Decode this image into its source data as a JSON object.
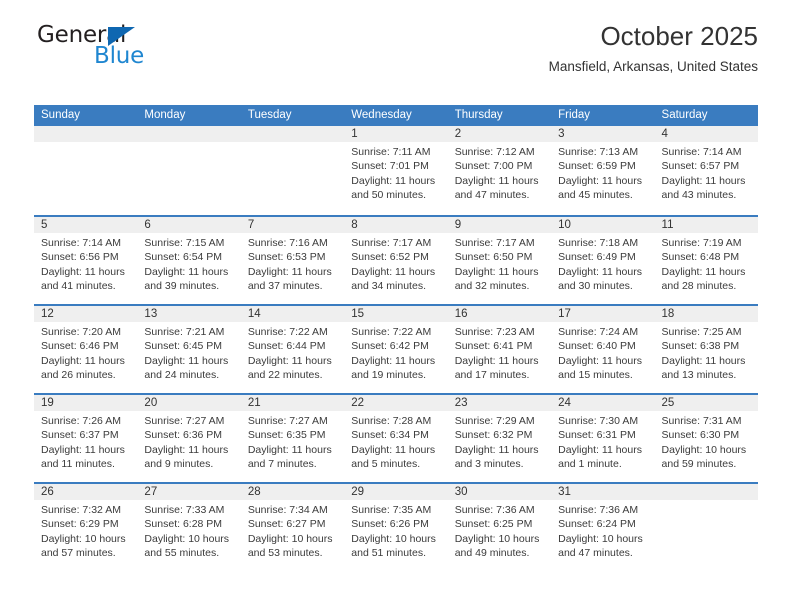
{
  "logo": {
    "word1": "General",
    "word2": "Blue",
    "triangle_color": "#0f67b1",
    "word2_color": "#1f86d0"
  },
  "header": {
    "title": "October 2025",
    "subtitle": "Mansfield, Arkansas, United States"
  },
  "theme": {
    "header_blue": "#3a7cc0",
    "daynum_band": "#efefef"
  },
  "calendar": {
    "day_headers": [
      "Sunday",
      "Monday",
      "Tuesday",
      "Wednesday",
      "Thursday",
      "Friday",
      "Saturday"
    ],
    "weeks": [
      [
        {
          "day": "",
          "empty": true
        },
        {
          "day": "",
          "empty": true
        },
        {
          "day": "",
          "empty": true
        },
        {
          "day": "1",
          "sunrise": "Sunrise: 7:11 AM",
          "sunset": "Sunset: 7:01 PM",
          "daylight": "Daylight: 11 hours and 50 minutes."
        },
        {
          "day": "2",
          "sunrise": "Sunrise: 7:12 AM",
          "sunset": "Sunset: 7:00 PM",
          "daylight": "Daylight: 11 hours and 47 minutes."
        },
        {
          "day": "3",
          "sunrise": "Sunrise: 7:13 AM",
          "sunset": "Sunset: 6:59 PM",
          "daylight": "Daylight: 11 hours and 45 minutes."
        },
        {
          "day": "4",
          "sunrise": "Sunrise: 7:14 AM",
          "sunset": "Sunset: 6:57 PM",
          "daylight": "Daylight: 11 hours and 43 minutes."
        }
      ],
      [
        {
          "day": "5",
          "sunrise": "Sunrise: 7:14 AM",
          "sunset": "Sunset: 6:56 PM",
          "daylight": "Daylight: 11 hours and 41 minutes."
        },
        {
          "day": "6",
          "sunrise": "Sunrise: 7:15 AM",
          "sunset": "Sunset: 6:54 PM",
          "daylight": "Daylight: 11 hours and 39 minutes."
        },
        {
          "day": "7",
          "sunrise": "Sunrise: 7:16 AM",
          "sunset": "Sunset: 6:53 PM",
          "daylight": "Daylight: 11 hours and 37 minutes."
        },
        {
          "day": "8",
          "sunrise": "Sunrise: 7:17 AM",
          "sunset": "Sunset: 6:52 PM",
          "daylight": "Daylight: 11 hours and 34 minutes."
        },
        {
          "day": "9",
          "sunrise": "Sunrise: 7:17 AM",
          "sunset": "Sunset: 6:50 PM",
          "daylight": "Daylight: 11 hours and 32 minutes."
        },
        {
          "day": "10",
          "sunrise": "Sunrise: 7:18 AM",
          "sunset": "Sunset: 6:49 PM",
          "daylight": "Daylight: 11 hours and 30 minutes."
        },
        {
          "day": "11",
          "sunrise": "Sunrise: 7:19 AM",
          "sunset": "Sunset: 6:48 PM",
          "daylight": "Daylight: 11 hours and 28 minutes."
        }
      ],
      [
        {
          "day": "12",
          "sunrise": "Sunrise: 7:20 AM",
          "sunset": "Sunset: 6:46 PM",
          "daylight": "Daylight: 11 hours and 26 minutes."
        },
        {
          "day": "13",
          "sunrise": "Sunrise: 7:21 AM",
          "sunset": "Sunset: 6:45 PM",
          "daylight": "Daylight: 11 hours and 24 minutes."
        },
        {
          "day": "14",
          "sunrise": "Sunrise: 7:22 AM",
          "sunset": "Sunset: 6:44 PM",
          "daylight": "Daylight: 11 hours and 22 minutes."
        },
        {
          "day": "15",
          "sunrise": "Sunrise: 7:22 AM",
          "sunset": "Sunset: 6:42 PM",
          "daylight": "Daylight: 11 hours and 19 minutes."
        },
        {
          "day": "16",
          "sunrise": "Sunrise: 7:23 AM",
          "sunset": "Sunset: 6:41 PM",
          "daylight": "Daylight: 11 hours and 17 minutes."
        },
        {
          "day": "17",
          "sunrise": "Sunrise: 7:24 AM",
          "sunset": "Sunset: 6:40 PM",
          "daylight": "Daylight: 11 hours and 15 minutes."
        },
        {
          "day": "18",
          "sunrise": "Sunrise: 7:25 AM",
          "sunset": "Sunset: 6:38 PM",
          "daylight": "Daylight: 11 hours and 13 minutes."
        }
      ],
      [
        {
          "day": "19",
          "sunrise": "Sunrise: 7:26 AM",
          "sunset": "Sunset: 6:37 PM",
          "daylight": "Daylight: 11 hours and 11 minutes."
        },
        {
          "day": "20",
          "sunrise": "Sunrise: 7:27 AM",
          "sunset": "Sunset: 6:36 PM",
          "daylight": "Daylight: 11 hours and 9 minutes."
        },
        {
          "day": "21",
          "sunrise": "Sunrise: 7:27 AM",
          "sunset": "Sunset: 6:35 PM",
          "daylight": "Daylight: 11 hours and 7 minutes."
        },
        {
          "day": "22",
          "sunrise": "Sunrise: 7:28 AM",
          "sunset": "Sunset: 6:34 PM",
          "daylight": "Daylight: 11 hours and 5 minutes."
        },
        {
          "day": "23",
          "sunrise": "Sunrise: 7:29 AM",
          "sunset": "Sunset: 6:32 PM",
          "daylight": "Daylight: 11 hours and 3 minutes."
        },
        {
          "day": "24",
          "sunrise": "Sunrise: 7:30 AM",
          "sunset": "Sunset: 6:31 PM",
          "daylight": "Daylight: 11 hours and 1 minute."
        },
        {
          "day": "25",
          "sunrise": "Sunrise: 7:31 AM",
          "sunset": "Sunset: 6:30 PM",
          "daylight": "Daylight: 10 hours and 59 minutes."
        }
      ],
      [
        {
          "day": "26",
          "sunrise": "Sunrise: 7:32 AM",
          "sunset": "Sunset: 6:29 PM",
          "daylight": "Daylight: 10 hours and 57 minutes."
        },
        {
          "day": "27",
          "sunrise": "Sunrise: 7:33 AM",
          "sunset": "Sunset: 6:28 PM",
          "daylight": "Daylight: 10 hours and 55 minutes."
        },
        {
          "day": "28",
          "sunrise": "Sunrise: 7:34 AM",
          "sunset": "Sunset: 6:27 PM",
          "daylight": "Daylight: 10 hours and 53 minutes."
        },
        {
          "day": "29",
          "sunrise": "Sunrise: 7:35 AM",
          "sunset": "Sunset: 6:26 PM",
          "daylight": "Daylight: 10 hours and 51 minutes."
        },
        {
          "day": "30",
          "sunrise": "Sunrise: 7:36 AM",
          "sunset": "Sunset: 6:25 PM",
          "daylight": "Daylight: 10 hours and 49 minutes."
        },
        {
          "day": "31",
          "sunrise": "Sunrise: 7:36 AM",
          "sunset": "Sunset: 6:24 PM",
          "daylight": "Daylight: 10 hours and 47 minutes."
        },
        {
          "day": "",
          "empty": true
        }
      ]
    ]
  }
}
